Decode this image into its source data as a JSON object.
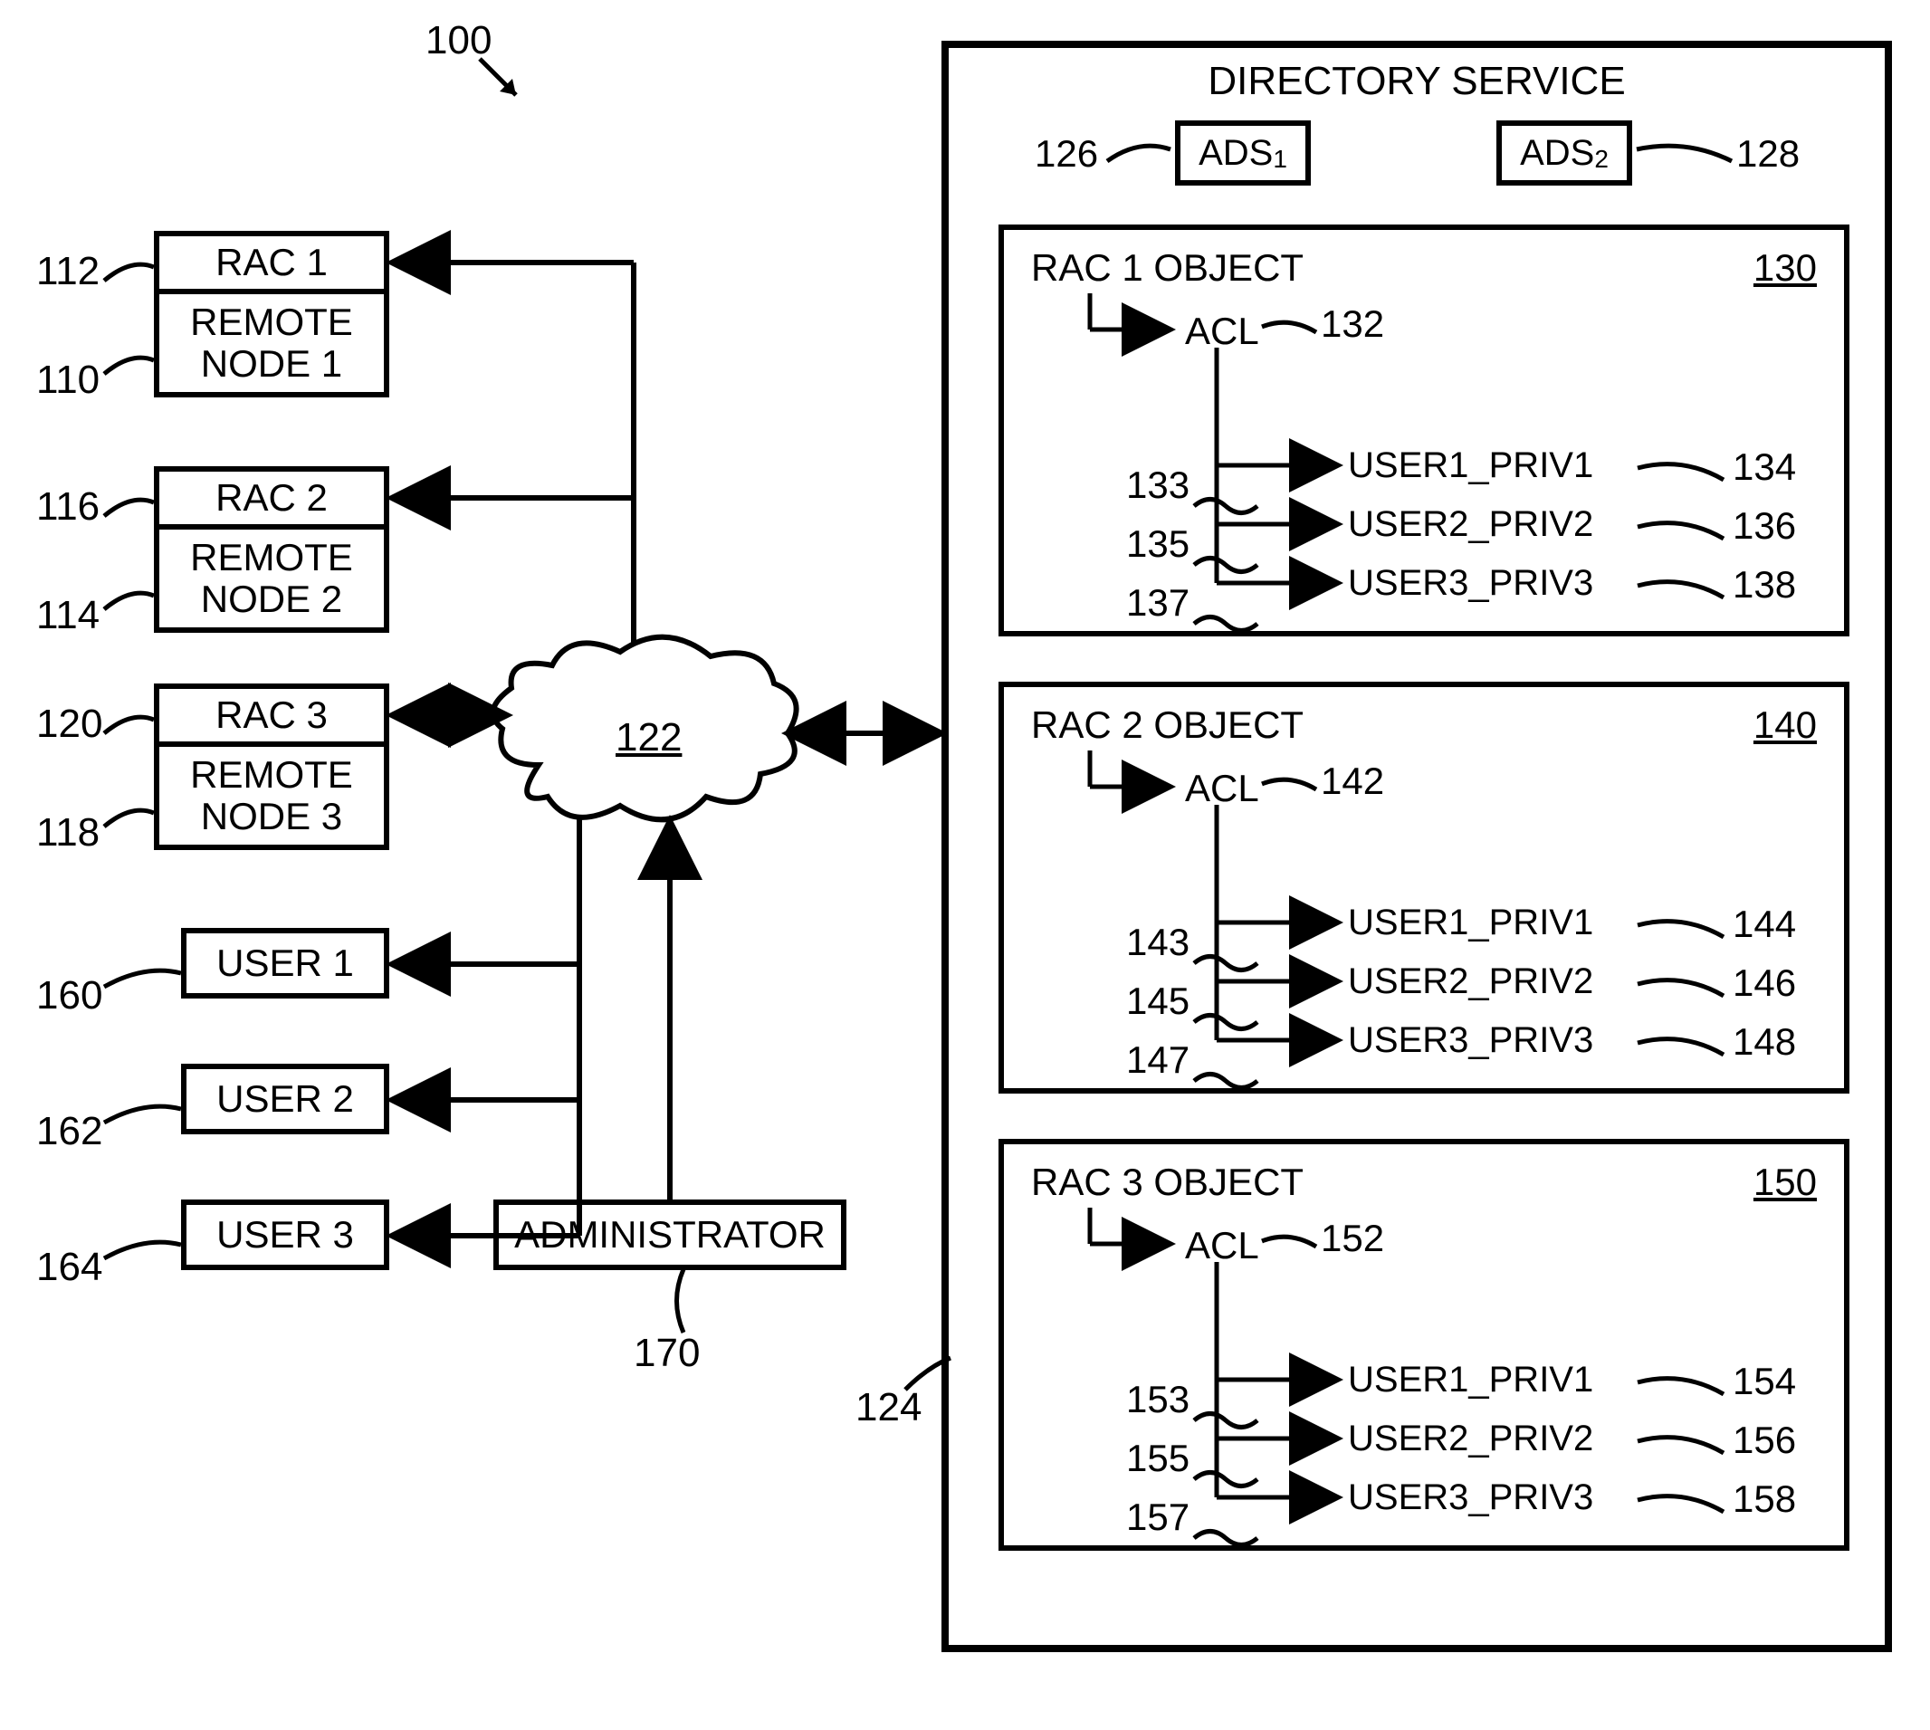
{
  "diagram_id": "100",
  "cloud_id": "122",
  "left": {
    "rac1": {
      "top": "RAC 1",
      "bot": "REMOTE\nNODE 1",
      "ref_top": "112",
      "ref_bot": "110"
    },
    "rac2": {
      "top": "RAC 2",
      "bot": "REMOTE\nNODE 2",
      "ref_top": "116",
      "ref_bot": "114"
    },
    "rac3": {
      "top": "RAC 3",
      "bot": "REMOTE\nNODE 3",
      "ref_top": "120",
      "ref_bot": "118"
    },
    "user1": {
      "label": "USER 1",
      "ref": "160"
    },
    "user2": {
      "label": "USER 2",
      "ref": "162"
    },
    "user3": {
      "label": "USER 3",
      "ref": "164"
    },
    "admin": {
      "label": "ADMINISTRATOR",
      "ref": "170"
    }
  },
  "ds": {
    "title": "DIRECTORY SERVICE",
    "ref": "124",
    "ads1": {
      "label": "ADS",
      "sub": "1",
      "ref": "126"
    },
    "ads2": {
      "label": "ADS",
      "sub": "2",
      "ref": "128"
    },
    "rac1": {
      "title": "RAC 1 OBJECT",
      "id": "130",
      "acl": "ACL",
      "acl_ref": "132",
      "refs_left": [
        "133",
        "135",
        "137"
      ],
      "refs_right": [
        "134",
        "136",
        "138"
      ],
      "privs": [
        "USER1_PRIV1",
        "USER2_PRIV2",
        "USER3_PRIV3"
      ]
    },
    "rac2": {
      "title": "RAC 2 OBJECT",
      "id": "140",
      "acl": "ACL",
      "acl_ref": "142",
      "refs_left": [
        "143",
        "145",
        "147"
      ],
      "refs_right": [
        "144",
        "146",
        "148"
      ],
      "privs": [
        "USER1_PRIV1",
        "USER2_PRIV2",
        "USER3_PRIV3"
      ]
    },
    "rac3": {
      "title": "RAC 3 OBJECT",
      "id": "150",
      "acl": "ACL",
      "acl_ref": "152",
      "refs_left": [
        "153",
        "155",
        "157"
      ],
      "refs_right": [
        "154",
        "156",
        "158"
      ],
      "privs": [
        "USER1_PRIV1",
        "USER2_PRIV2",
        "USER3_PRIV3"
      ]
    }
  }
}
